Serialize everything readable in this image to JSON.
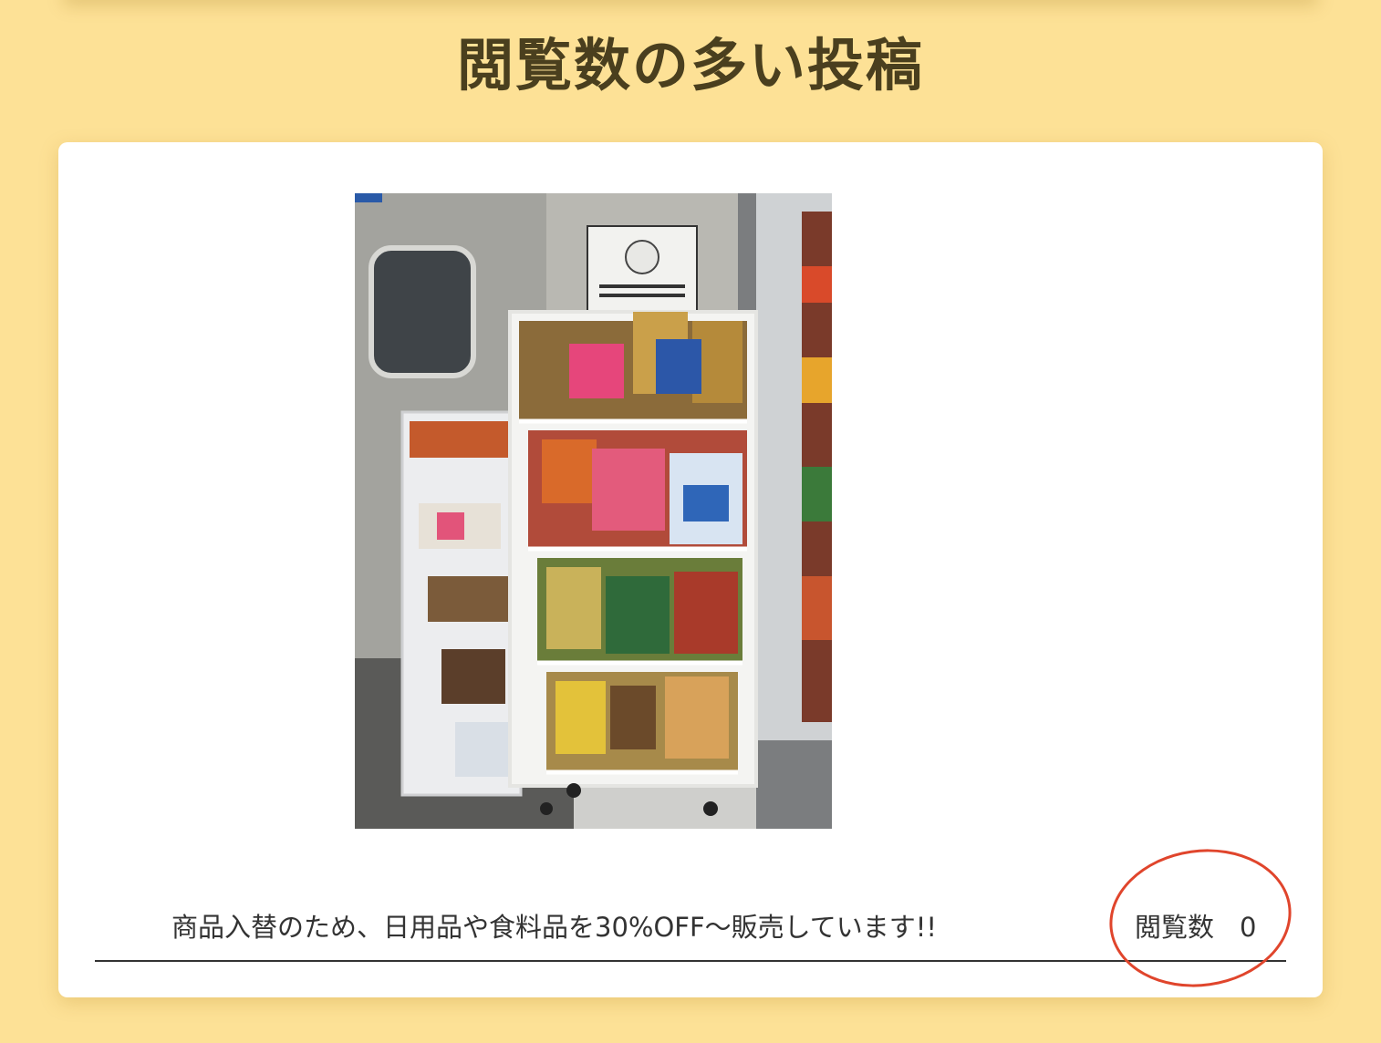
{
  "page": {
    "title": "閲覧数の多い投稿"
  },
  "post": {
    "image_alt": "Store display rack with discounted snacks and groceries",
    "caption": "商品入替のため、日用品や食料品を30%OFF〜販売しています!!",
    "view_label": "閲覧数",
    "view_count": "0"
  },
  "colors": {
    "background": "#fde196",
    "card": "#ffffff",
    "title_text": "#4a3f1e",
    "body_text": "#333333",
    "highlight_ring": "#e0452c"
  }
}
